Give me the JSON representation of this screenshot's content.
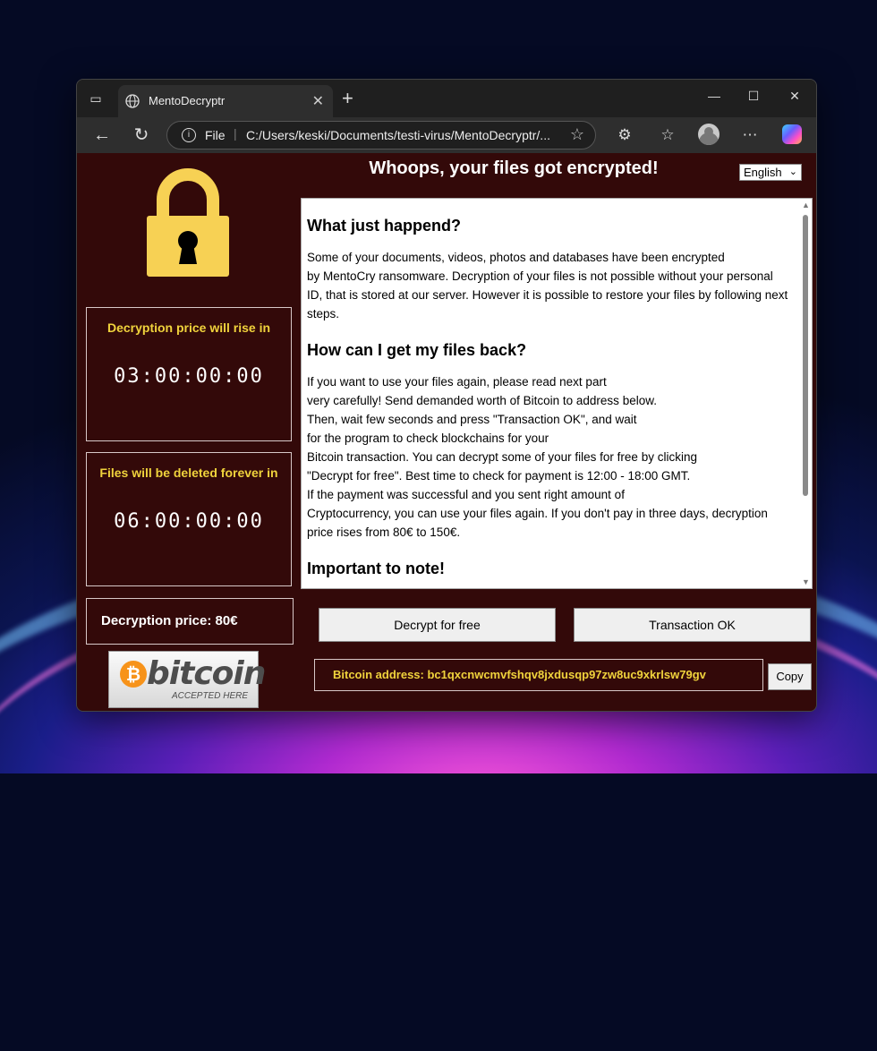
{
  "browser": {
    "tab_title": "MentoDecryptr",
    "url_protocol": "File",
    "url_path": "C:/Users/keski/Documents/testi-virus/MentoDecryptr/..."
  },
  "app": {
    "headline": "Whoops, your files got encrypted!",
    "language": "English",
    "price_rise": {
      "title": "Decryption price will rise in",
      "countdown": "03:00:00:00"
    },
    "delete": {
      "title": "Files will be deleted forever in",
      "countdown": "06:00:00:00"
    },
    "price_label": "Decryption price: 80€",
    "bitcoin_logo": {
      "word": "bitcoin",
      "sub": "ACCEPTED HERE"
    },
    "sections": [
      {
        "heading": "What just happend?",
        "body": "Some of your documents, videos, photos and databases have been encrypted\nby MentoCry ransomware. Decryption of your files is not possible without your personal ID, that is stored at our server. However it is possible to restore your files by following next steps."
      },
      {
        "heading": "How can I get my files back?",
        "body": "If you want to use your files again, please read next part\nvery carefully! Send demanded worth of Bitcoin to address below.\nThen, wait few seconds and press \"Transaction OK\", and wait\nfor the program to check blockchains for your\nBitcoin transaction. You can decrypt some of your files for free by clicking\n\"Decrypt for free\". Best time to check for payment is 12:00 - 18:00 GMT.\nIf the payment was successful and you sent right amount of\nCryptocurrency, you can use your files again. If you don't pay in three days, decryption price rises from 80€ to 150€."
      },
      {
        "heading": "Important to note!",
        "body": ""
      }
    ],
    "decrypt_button": "Decrypt for free",
    "transaction_button": "Transaction OK",
    "bitcoin_address": "Bitcoin address: bc1qxcnwcmvfshqv8jxdusqp97zw8uc9xkrlsw79gv",
    "copy_button": "Copy"
  },
  "colors": {
    "background": "#330909",
    "accent": "#f0d33c",
    "lock": "#f7d154"
  }
}
